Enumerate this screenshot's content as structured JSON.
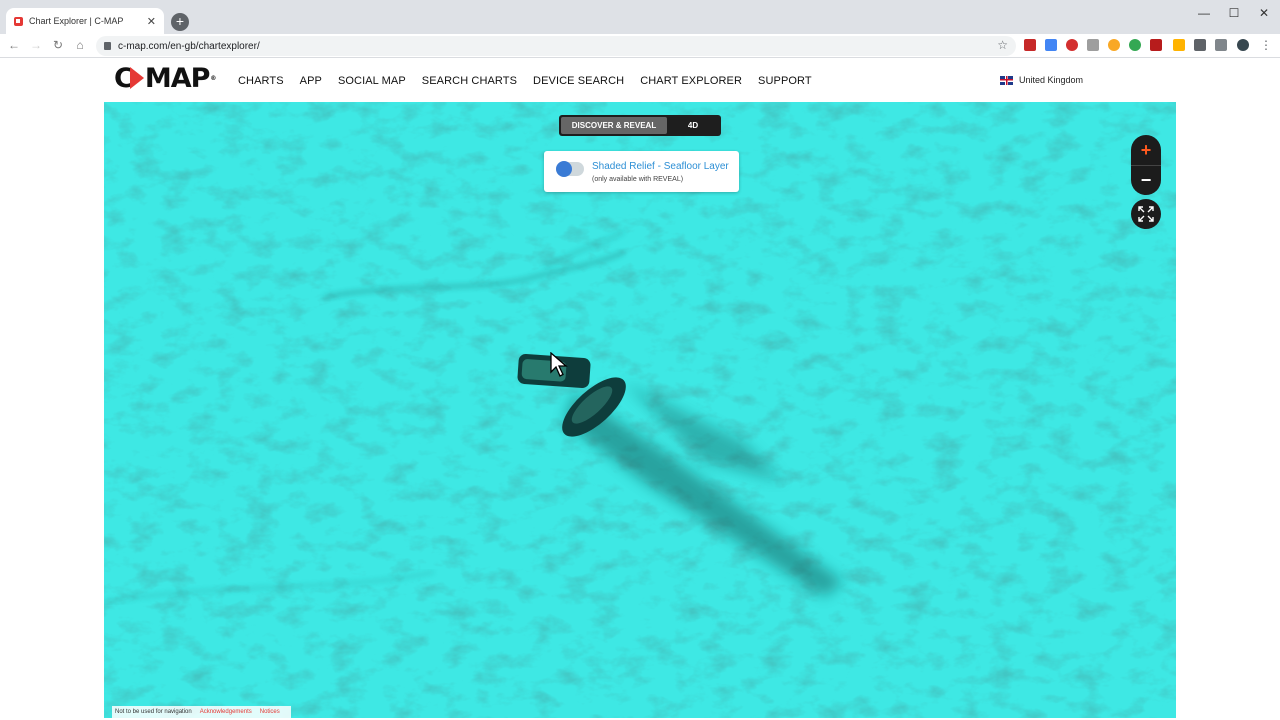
{
  "browser": {
    "tab_title": "Chart Explorer | C-MAP",
    "url": "c-map.com/en-gb/chartexplorer/"
  },
  "site": {
    "logo": "C▷MAP",
    "nav": [
      "CHARTS",
      "APP",
      "SOCIAL MAP",
      "SEARCH CHARTS",
      "DEVICE SEARCH",
      "CHART EXPLORER",
      "SUPPORT"
    ],
    "country": "United Kingdom"
  },
  "map": {
    "mode_options": [
      "DISCOVER & REVEAL",
      "4D"
    ],
    "active_mode": "DISCOVER & REVEAL",
    "layer_title": "Shaded Relief - Seafloor Layer",
    "layer_subtitle": "(only available with REVEAL)",
    "layer_enabled": true,
    "zoom_in": "+",
    "zoom_out": "−",
    "footer": {
      "notice": "Not to be used for navigation",
      "acknowledgements": "Acknowledgements",
      "notices": "Notices"
    },
    "colors": {
      "sea": "#3ee8e4",
      "relief_dark": "#1a6b68",
      "control_bg": "#1c1c1c",
      "accent": "#ff5a1f"
    }
  }
}
